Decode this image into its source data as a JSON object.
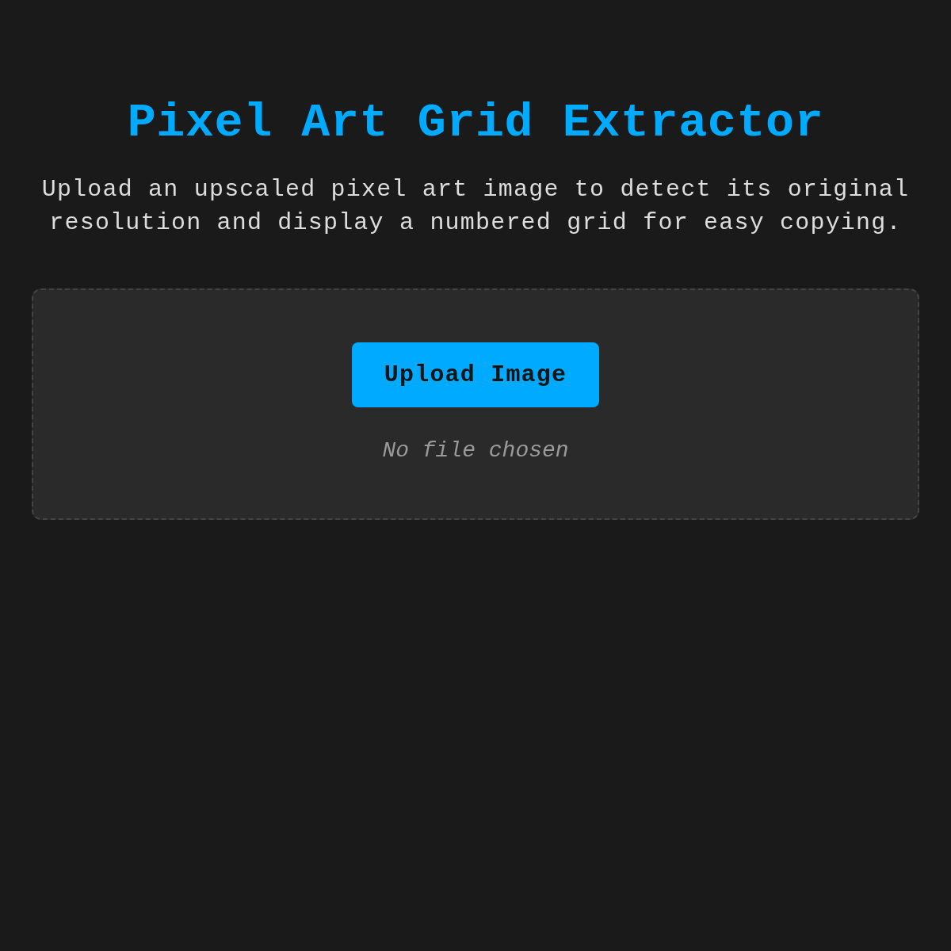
{
  "title": "Pixel Art Grid Extractor",
  "subtitle": "Upload an upscaled pixel art image to detect its original resolution and display a numbered grid for easy copying.",
  "upload": {
    "button": "Upload Image",
    "status": "No file chosen"
  }
}
